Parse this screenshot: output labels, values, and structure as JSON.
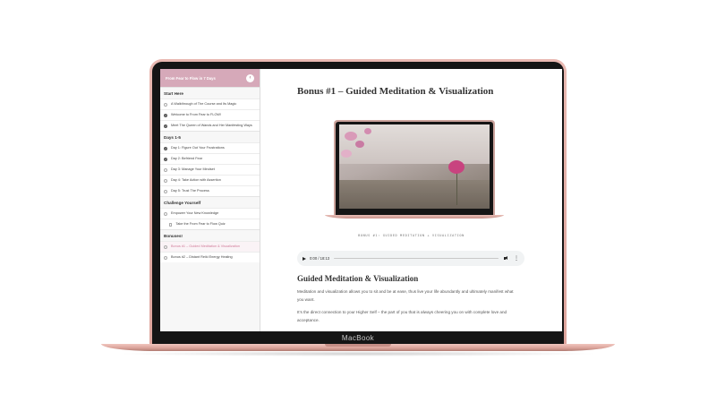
{
  "device": {
    "label": "MacBook"
  },
  "colors": {
    "accent": "#d6a9b9",
    "accent_text": "#d07b99",
    "rose_gold": "#e3aea6"
  },
  "sidebar": {
    "course_title": "From Fear to Flow in 7 Days",
    "collapse_icon": "chevron-left-icon",
    "sections": [
      {
        "title": "Start Here",
        "lessons": [
          {
            "label": "A Walkthrough of The Course and Its Magic",
            "status": "incomplete"
          },
          {
            "label": "Welcome to From Fear to FLOW!",
            "status": "complete"
          },
          {
            "label": "Meet The Queen of Wands and Her Manifesting Ways",
            "status": "complete"
          }
        ]
      },
      {
        "title": "Days 1-5",
        "lessons": [
          {
            "label": "Day 1: Figure Out Your Frustrations",
            "status": "complete"
          },
          {
            "label": "Day 2: Befriend Fear",
            "status": "complete"
          },
          {
            "label": "Day 3: Manage Your Mindset",
            "status": "incomplete"
          },
          {
            "label": "Day 4: Take Action with Assertion",
            "status": "incomplete"
          },
          {
            "label": "Day 5: Trust The Process",
            "status": "incomplete"
          }
        ]
      },
      {
        "title": "Challenge Yourself",
        "lessons": [
          {
            "label": "Empower Your New Knowledge",
            "status": "incomplete"
          },
          {
            "label": "Take the From Fear to Flow Quiz",
            "status": "quiz"
          }
        ]
      },
      {
        "title": "Bonuses!",
        "lessons": [
          {
            "label": "Bonus #1 – Guided Meditation & Visualization",
            "status": "active"
          },
          {
            "label": "Bonus #2 – Distant Reiki Energy Healing",
            "status": "incomplete"
          }
        ]
      }
    ]
  },
  "main": {
    "title": "Bonus #1 – Guided Meditation & Visualization",
    "image_caption": "BONUS #1: GUIDED MEDITATION + VISUALIZATION",
    "audio": {
      "time": "0:00 / 18:13",
      "progress": 0
    },
    "section_heading": "Guided Meditation & Visualization",
    "paragraphs": [
      "Meditation and visualization allows you to sit and be at ease, thus live your life abundantly and ultimately manifest what you want.",
      "It’s the direct connection to your Higher Self – the part of you that is always cheering you on with complete love and acceptance."
    ]
  }
}
